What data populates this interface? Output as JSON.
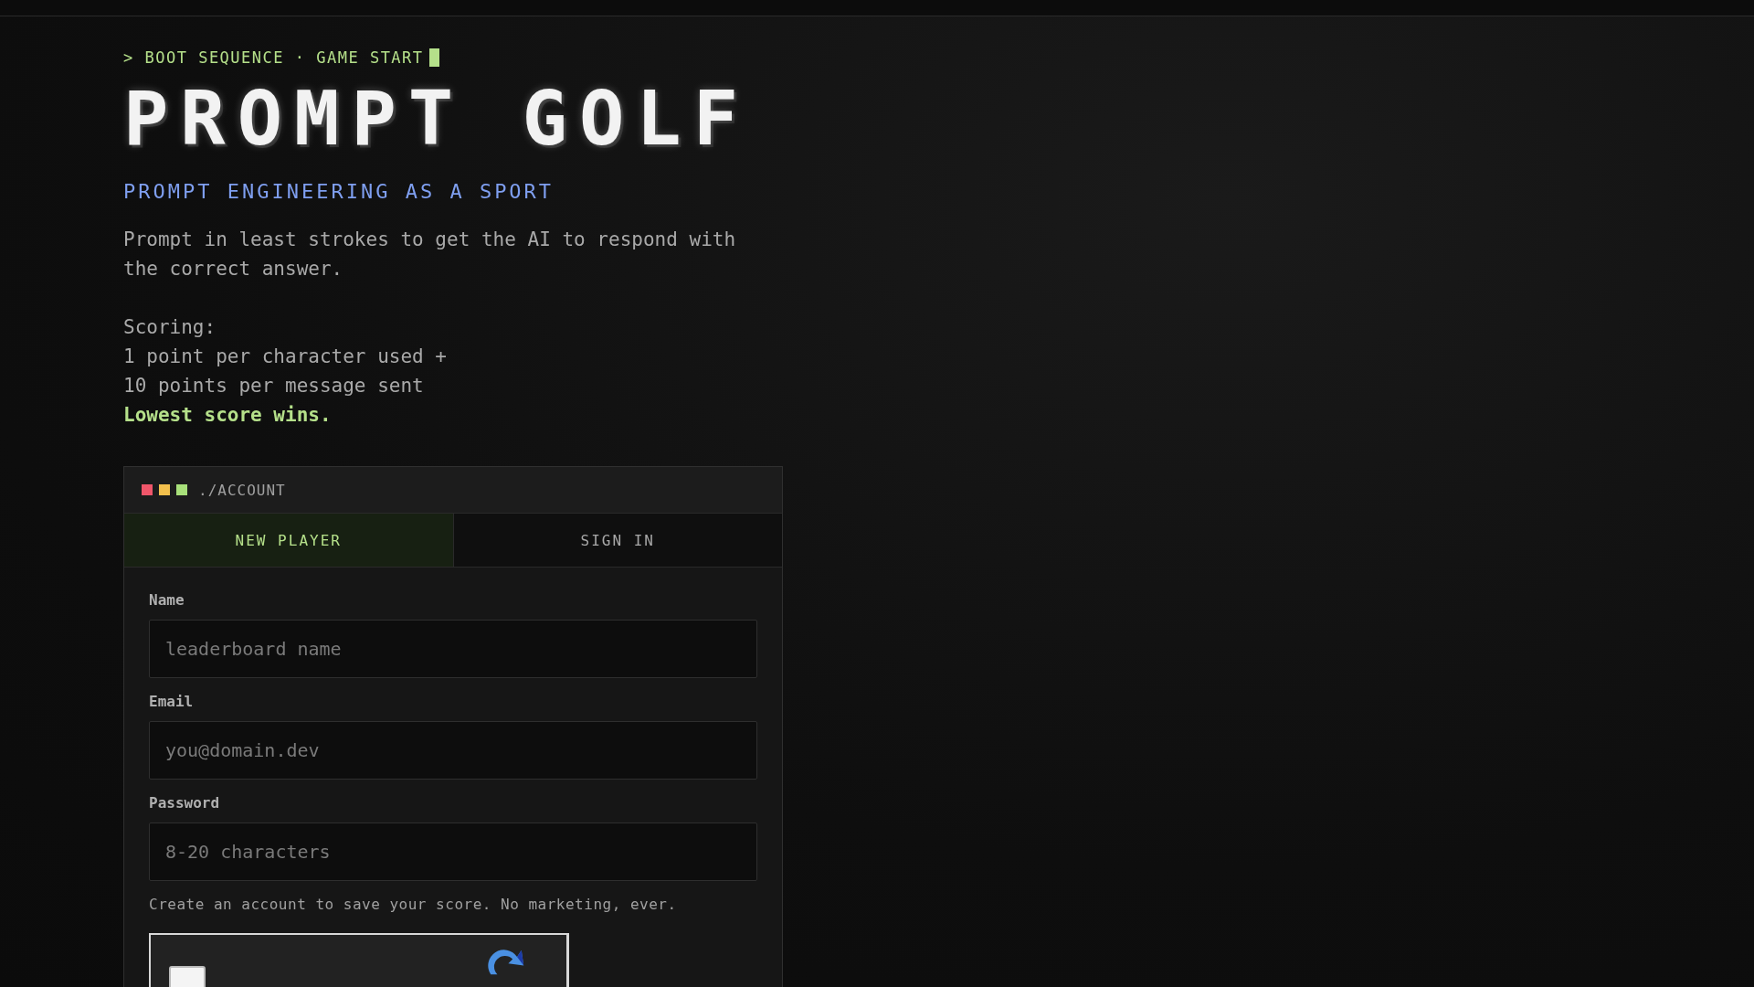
{
  "boot_line": "> BOOT SEQUENCE · GAME START",
  "title": "PROMPT GOLF",
  "tagline": "PROMPT ENGINEERING AS A SPORT",
  "description": "Prompt in least strokes to get the AI to respond with the correct answer.",
  "scoring": {
    "heading": "Scoring:",
    "lines": [
      "1 point per character used +",
      "10 points per message sent"
    ],
    "emphasis": "Lowest score wins."
  },
  "account_panel": {
    "title": "./ACCOUNT",
    "tabs": [
      {
        "label": "NEW PLAYER",
        "selected": true
      },
      {
        "label": "SIGN IN",
        "selected": false
      }
    ],
    "fields": [
      {
        "label": "Name",
        "placeholder": "leaderboard name"
      },
      {
        "label": "Email",
        "placeholder": "you@domain.dev"
      },
      {
        "label": "Password",
        "placeholder": "8-20 characters"
      }
    ],
    "note": "Create an account to save your score. No marketing, ever.",
    "captcha": {
      "checked": false
    }
  }
}
